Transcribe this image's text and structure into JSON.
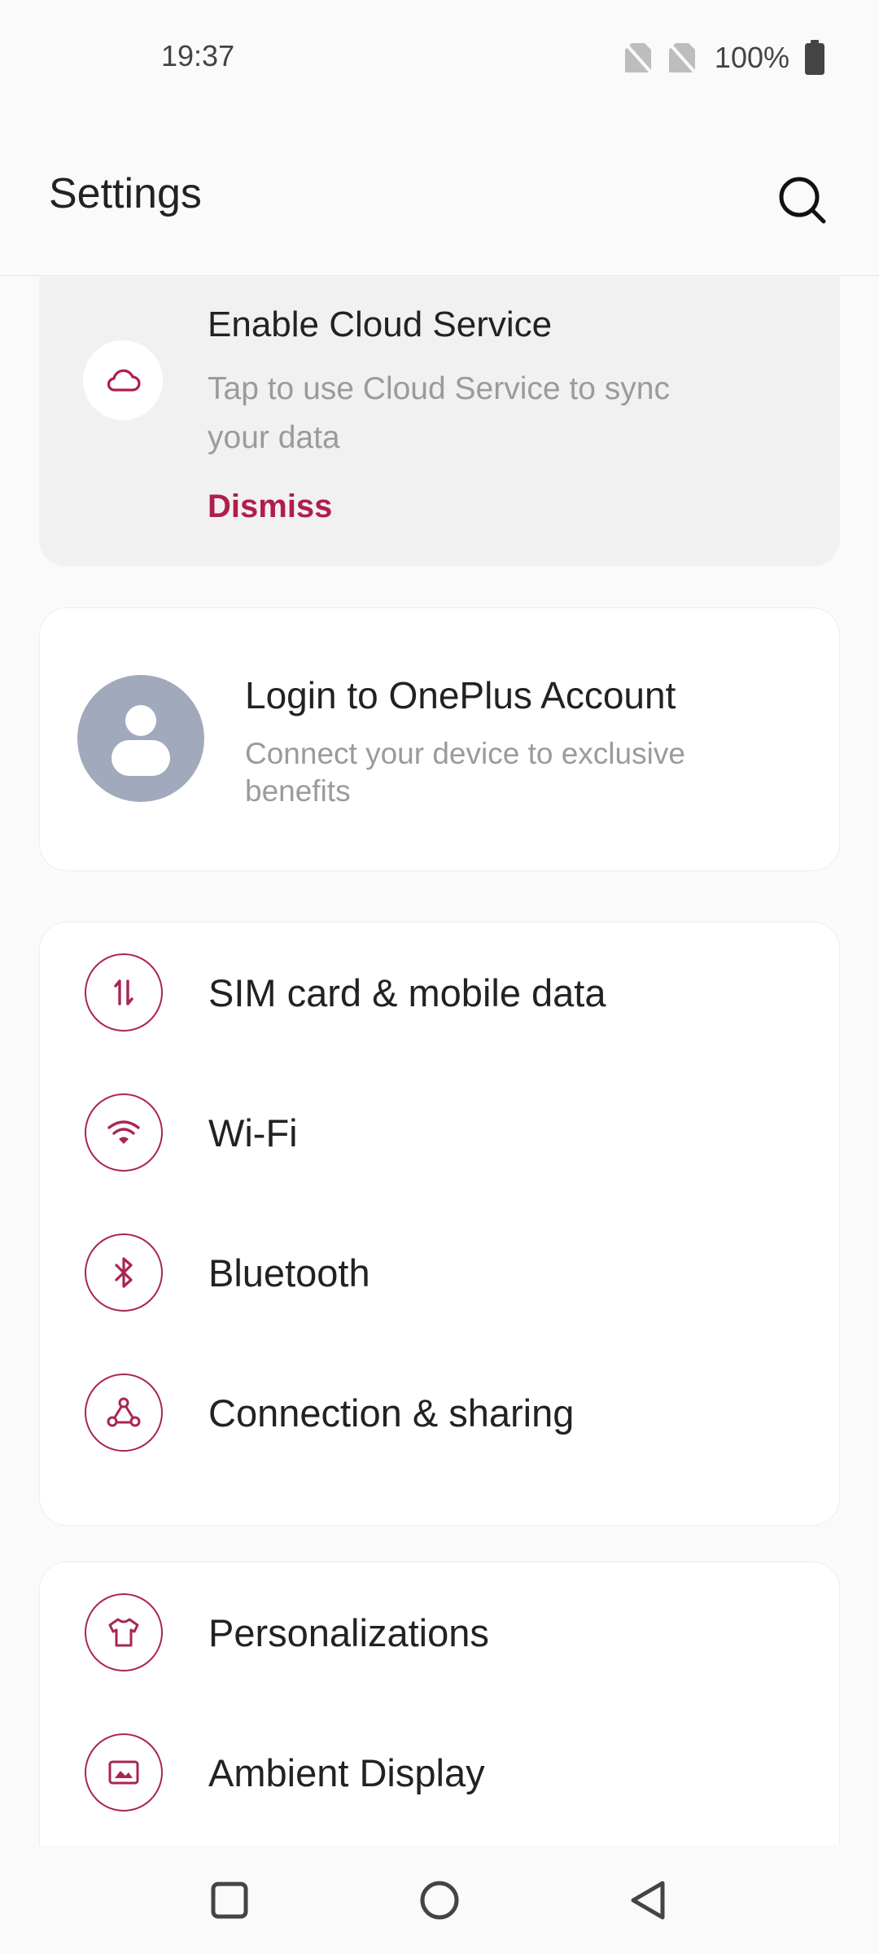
{
  "status_bar": {
    "time": "19:37",
    "battery_percent": "100%",
    "icons": [
      "no-sim-icon",
      "no-sim-icon",
      "battery-full-icon"
    ]
  },
  "app_bar": {
    "title": "Settings",
    "search_icon": "search-icon"
  },
  "cloud_card": {
    "title": "Enable Cloud Service",
    "subtitle": "Tap to use Cloud Service to sync your data",
    "dismiss_label": "Dismiss",
    "icon": "cloud-icon"
  },
  "account_card": {
    "title": "Login to OnePlus Account",
    "subtitle": "Connect your device to exclusive benefits",
    "icon": "avatar-icon"
  },
  "connectivity_items": [
    {
      "label": "SIM card & mobile data",
      "icon": "mobile-data-icon"
    },
    {
      "label": "Wi-Fi",
      "icon": "wifi-icon"
    },
    {
      "label": "Bluetooth",
      "icon": "bluetooth-icon"
    },
    {
      "label": "Connection & sharing",
      "icon": "connection-sharing-icon"
    }
  ],
  "display_items": [
    {
      "label": "Personalizations",
      "icon": "shirt-icon"
    },
    {
      "label": "Ambient Display",
      "icon": "ambient-display-icon"
    }
  ],
  "nav_bar": {
    "icons": [
      "recents-icon",
      "home-icon",
      "back-icon"
    ]
  },
  "colors": {
    "accent": "#b01e4b",
    "icon_ring": "#a8264f",
    "avatar_bg": "#a1a9bc",
    "background": "#fafafa"
  }
}
